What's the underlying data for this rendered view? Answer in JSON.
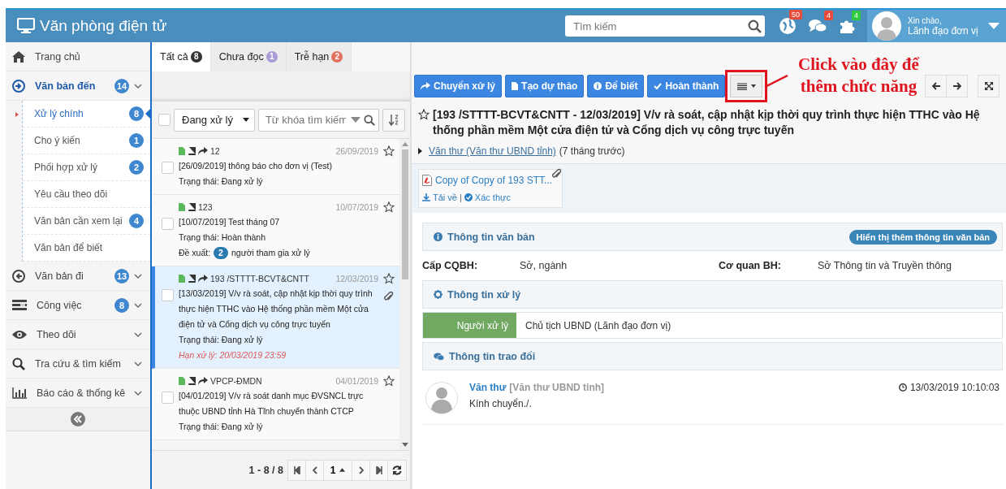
{
  "header": {
    "title": "Văn phòng điện tử",
    "search_placeholder": "Tìm kiếm",
    "notifications": [
      {
        "count": "50",
        "color": "#e74c3c"
      },
      {
        "count": "4",
        "color": "#e74c3c"
      },
      {
        "count": "4",
        "color": "#2ecc40"
      }
    ],
    "greeting": "Xin chào,",
    "user": "Lãnh đạo đơn vị"
  },
  "sidebar": {
    "items": [
      {
        "label": "Trang chủ",
        "selected": false
      },
      {
        "label": "Văn bản đến",
        "count": "14",
        "selected": true,
        "collapsible": true,
        "expanded": true,
        "children": [
          {
            "label": "Xử lý chính",
            "count": "8",
            "selected": true
          },
          {
            "label": "Cho ý kiến",
            "count": "1",
            "selected": false
          },
          {
            "label": "Phối hợp xử lý",
            "count": "2",
            "selected": false
          },
          {
            "label": "Yêu cầu theo dõi",
            "selected": false
          },
          {
            "label": "Văn bản cần xem lại",
            "count": "4",
            "selected": false
          },
          {
            "label": "Văn bản để biết",
            "selected": false
          }
        ]
      },
      {
        "label": "Văn bản đi",
        "count": "13",
        "selected": false,
        "collapsible": true
      },
      {
        "label": "Công việc",
        "count": "8",
        "selected": false,
        "collapsible": true
      },
      {
        "label": "Theo dõi",
        "selected": false,
        "collapsible": true
      },
      {
        "label": "Tra cứu & tìm kiếm",
        "selected": false,
        "collapsible": true
      },
      {
        "label": "Báo cáo & thống kê",
        "selected": false,
        "collapsible": true
      }
    ]
  },
  "tabs": [
    {
      "label": "Tất cả",
      "count": "8",
      "color": "#333333",
      "selected": true
    },
    {
      "label": "Chưa đọc",
      "count": "1",
      "color": "#a99bd6",
      "selected": false
    },
    {
      "label": "Trễ hạn",
      "count": "2",
      "color": "#e07060",
      "selected": false
    }
  ],
  "list": {
    "filter": {
      "checked": false,
      "status": "Đang xử lý",
      "placeholder": "Từ khóa tìm kiếm"
    },
    "items": [
      {
        "number": "12",
        "date": "26/09/2019",
        "summary": "[26/09/2019] thông báo cho đơn vị (Test)",
        "status": "Trạng thái: Đang xử lý",
        "forwarded": true,
        "attachment": false,
        "starred": false,
        "checked": false,
        "selected": false
      },
      {
        "number": "123",
        "date": "10/07/2019",
        "summary": "[10/07/2019] Test tháng 07",
        "status": "Trạng thái: Hoàn thành",
        "proposal": {
          "label": "Đề xuất:",
          "count": "2",
          "text": "người tham gia xử lý"
        },
        "forwarded": false,
        "attachment": false,
        "starred": false,
        "checked": false,
        "selected": false
      },
      {
        "number": "193 /STTTT-BCVT&CNTT",
        "date": "12/03/2019",
        "summary": "[13/03/2019] V/v rà soát, cập nhật kịp thời quy trình thực hiện TTHC vào Hệ thống phần mềm Một cửa điện tử và Cổng dịch vụ công trực tuyến",
        "status": "Trạng thái: Đang xử lý",
        "deadline": "Hạn xử lý: 20/03/2019 23:59",
        "forwarded": true,
        "attachment": true,
        "starred": false,
        "checked": false,
        "selected": true
      },
      {
        "number": "VPCP-ĐMDN",
        "date": "04/01/2019",
        "summary": "[04/01/2019] V/v rà soát danh mục ĐVSNCL trực thuộc UBND tỉnh Hà Tĩnh chuyển thành CTCP",
        "status": "Trạng thái: Đang xử lý",
        "forwarded": true,
        "attachment": false,
        "starred": false,
        "checked": false,
        "selected": false
      }
    ],
    "pagination": {
      "range": "1 - 8 / 8",
      "page": "1"
    }
  },
  "detail": {
    "buttons": [
      {
        "label": "Chuyển xử lý",
        "kind": "forward"
      },
      {
        "label": "Tạo dự thảo",
        "kind": "draft"
      },
      {
        "label": "Để biết",
        "kind": "info"
      },
      {
        "label": "Hoàn thành",
        "kind": "done"
      }
    ],
    "title": "[193 /STTTT-BCVT&CNTT - 12/03/2019] V/v rà soát, cập nhật kịp thời quy trình thực hiện TTHC vào Hệ thống phần mềm Một cửa điện tử và Cổng dịch vụ công trực tuyến",
    "starred": false,
    "sender": "Văn thư (Văn thư UBND tỉnh)",
    "sent_ago": "(7 tháng trước)",
    "attachment": {
      "name": "Copy of Copy of 193 STT...",
      "download": "Tải về",
      "separator": "|",
      "verify": "Xác thực"
    },
    "info": {
      "heading": "Thông tin văn bản",
      "more_button": "Hiển thị thêm thông tin văn bản",
      "fields": [
        {
          "label": "Cấp CQBH:",
          "value": "Sở, ngành"
        },
        {
          "label": "Cơ quan BH:",
          "value": "Sở Thông tin và Truyền thông"
        }
      ]
    },
    "processing": {
      "heading": "Thông tin xử lý",
      "rows": [
        {
          "label": "Người xử lý",
          "value": "Chủ tịch UBND (Lãnh đạo đơn vị)"
        }
      ]
    },
    "exchange": {
      "heading": "Thông tin trao đổi",
      "comments": [
        {
          "author": "Văn thư",
          "unit": "[Văn thư UBND tỉnh]",
          "time": "13/03/2019 10:10:03",
          "text": "Kính chuyển./."
        }
      ]
    }
  },
  "annotation": {
    "text": "Click vào đây để thêm chức năng"
  }
}
